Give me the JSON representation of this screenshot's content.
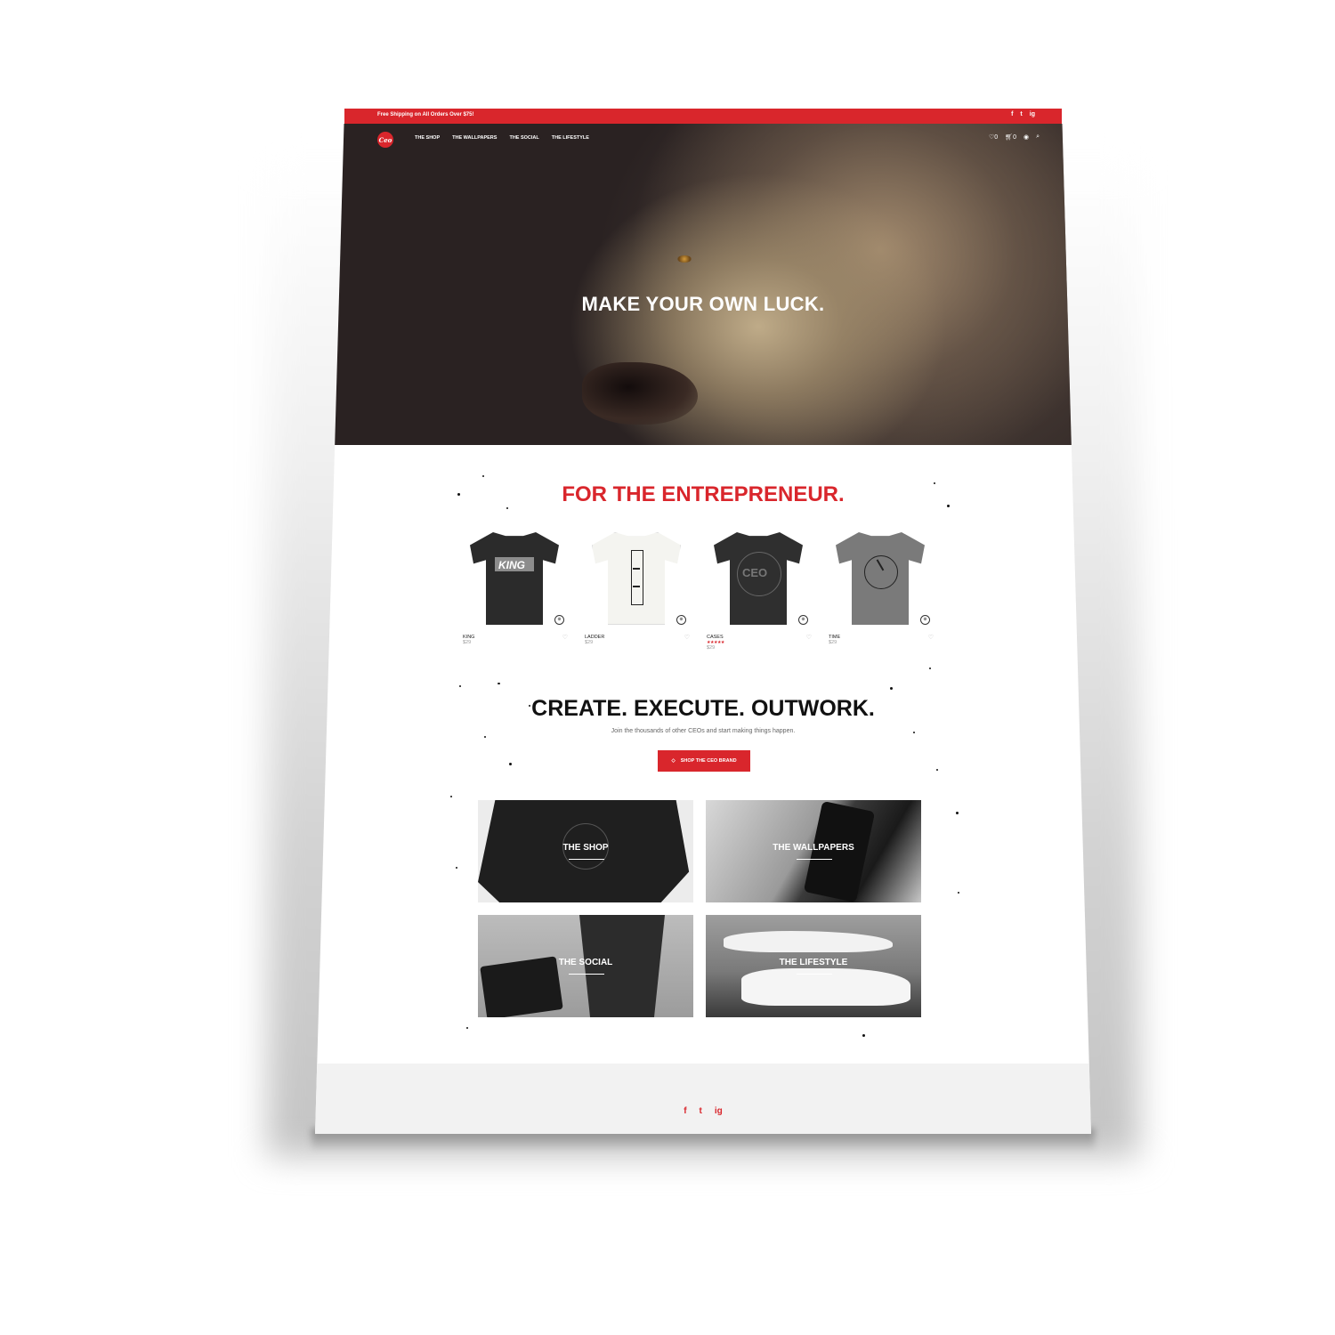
{
  "topbar": {
    "promo": "Free Shipping on All Orders Over $75!",
    "social": [
      "f",
      "t",
      "ig"
    ]
  },
  "nav": {
    "logo": "Ceo",
    "links": [
      "THE SHOP",
      "THE WALLPAPERS",
      "THE SOCIAL",
      "THE LIFESTYLE"
    ],
    "wishlist_count": "0",
    "cart_count": "0"
  },
  "hero": {
    "title": "MAKE YOUR OWN LUCK."
  },
  "featured": {
    "title": "FOR THE ENTREPRENEUR.",
    "products": [
      {
        "name": "KING",
        "price": "$29",
        "tee_color": "#2b2b2b",
        "graphic": "KING"
      },
      {
        "name": "LADDER",
        "price": "$29",
        "tee_color": "#f4f4f0",
        "graphic": "ladder"
      },
      {
        "name": "CASES",
        "price": "$29",
        "tee_color": "#2f2f2f",
        "graphic": "CEO",
        "stars": "★★★★★"
      },
      {
        "name": "TIME",
        "price": "$29",
        "tee_color": "#7a7a7a",
        "graphic": "time"
      }
    ]
  },
  "promo": {
    "title": "CREATE. EXECUTE. OUTWORK.",
    "subtitle": "Join the thousands of other CEOs and start making things happen.",
    "cta": "SHOP THE CEO BRAND"
  },
  "tiles": [
    {
      "label": "THE SHOP"
    },
    {
      "label": "THE WALLPAPERS"
    },
    {
      "label": "THE SOCIAL"
    },
    {
      "label": "THE LIFESTYLE"
    }
  ],
  "footer": {
    "social": [
      "f",
      "t",
      "ig"
    ]
  },
  "colors": {
    "accent": "#d9262c",
    "hero_bg": "#2a2222"
  }
}
